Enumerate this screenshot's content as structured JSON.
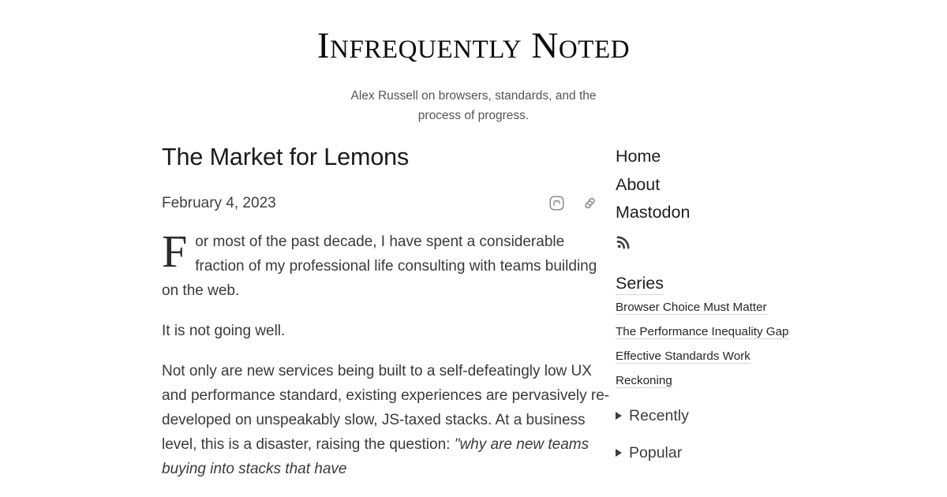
{
  "site": {
    "title": "Infrequently Noted",
    "tagline": "Alex Russell on browsers, standards, and the process of progress."
  },
  "post": {
    "title": "The Market for Lemons",
    "date": "February 4, 2023",
    "actions": [
      {
        "name": "mastodon-icon",
        "label": "Mastodon"
      },
      {
        "name": "permalink-icon",
        "label": "Permalink"
      }
    ],
    "paragraphs": [
      "For most of the past decade, I have spent a considerable fraction of my professional life consulting with teams building on the web.",
      "It is not going well.",
      "Not only are new services being built to a self-defeatingly low UX and performance standard, existing experiences are pervasively re-developed on unspeakably slow, JS-taxed stacks. At a business level, this is a disaster, raising the question: "
    ],
    "quote_fragment": "\"why are new teams buying into stacks that have"
  },
  "sidebar": {
    "nav": [
      {
        "label": "Home"
      },
      {
        "label": "About"
      },
      {
        "label": "Mastodon"
      }
    ],
    "feed": {
      "name": "rss-icon",
      "label": "RSS Feed"
    },
    "series_heading": "Series",
    "series": [
      {
        "label": "Browser Choice Must Matter"
      },
      {
        "label": "The Performance Inequality Gap"
      },
      {
        "label": "Effective Standards Work"
      },
      {
        "label": "Reckoning"
      }
    ],
    "disclosures": [
      {
        "label": "Recently",
        "expanded": false
      },
      {
        "label": "Popular",
        "expanded": false
      }
    ]
  },
  "colors": {
    "background": "#ffffff",
    "title": "#0b0b0b",
    "body_text": "#3a3a3a",
    "muted_text": "#555555",
    "icon": "#8c8c8c",
    "underline": "#d7d7d7"
  }
}
